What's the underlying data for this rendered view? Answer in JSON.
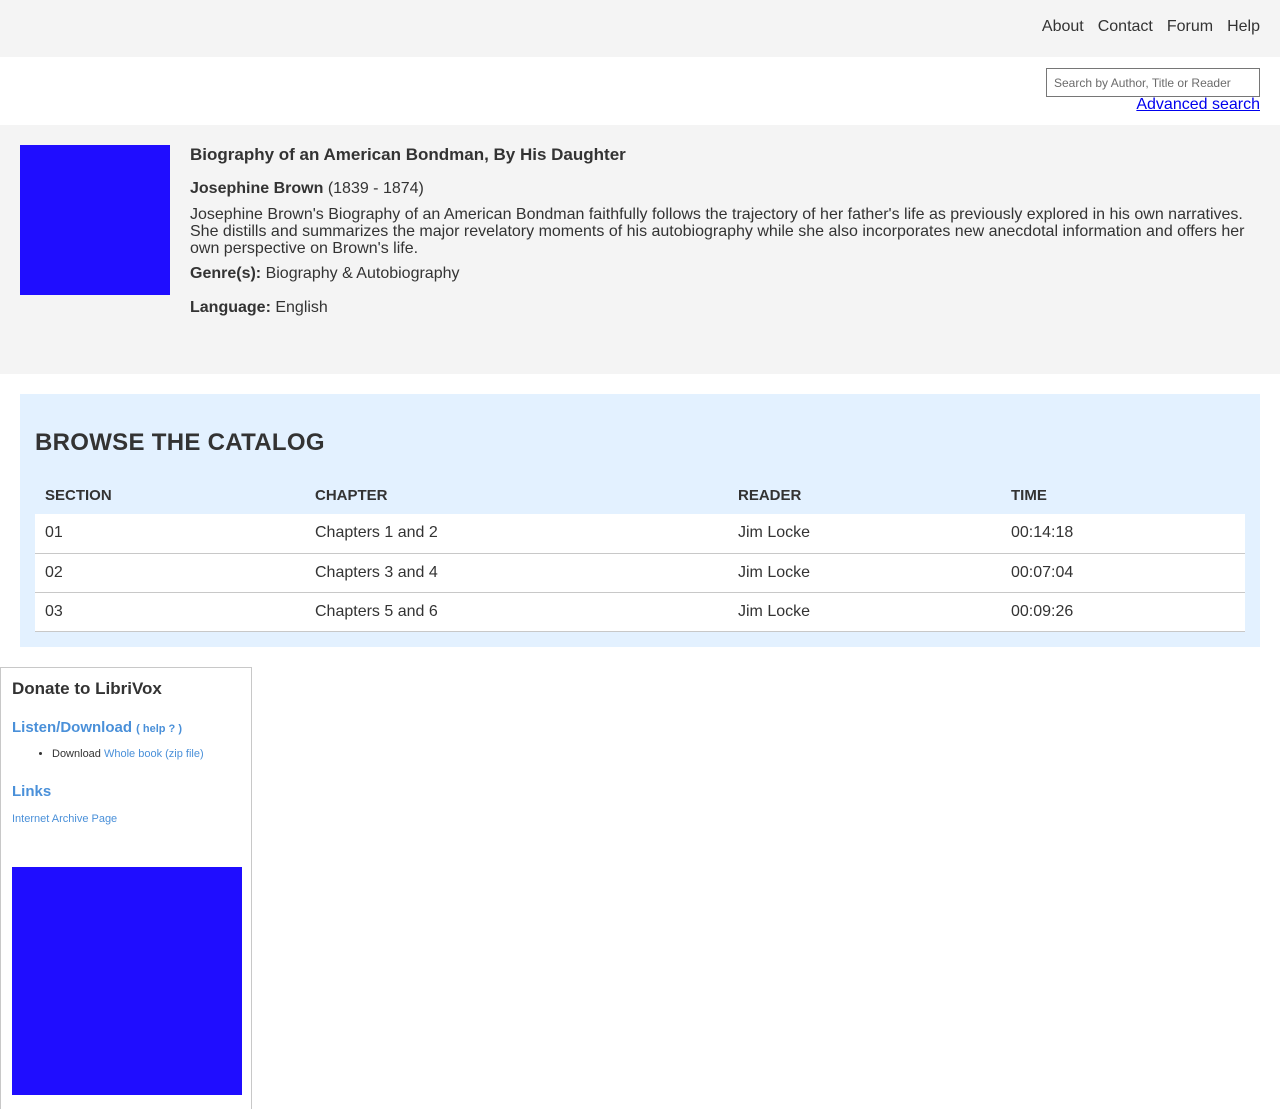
{
  "nav": {
    "items": [
      "About",
      "Contact",
      "Forum",
      "Help"
    ]
  },
  "search": {
    "placeholder": "Search by Author, Title or Reader",
    "advanced_label": "Advanced search"
  },
  "book": {
    "title": "Biography of an American Bondman, By His Daughter",
    "author": "Josephine Brown",
    "author_dates": "(1839 - 1874)",
    "description": "Josephine Brown's Biography of an American Bondman faithfully follows the trajectory of her father's life as previously explored in his own narratives. She distills and summarizes the major revelatory moments of his autobiography while she also incorporates new anecdotal information and offers her own perspective on Brown's life.",
    "genre_label": "Genre(s):",
    "genre": "Biography & Autobiography",
    "language_label": "Language:",
    "language": "English",
    "cover_color": "#1f0dff"
  },
  "catalog": {
    "title": "BROWSE THE CATALOG",
    "columns": [
      "SECTION",
      "CHAPTER",
      "READER",
      "TIME"
    ],
    "rows": [
      [
        "01",
        "Chapters 1 and 2",
        "Jim Locke",
        "00:14:18"
      ],
      [
        "02",
        "Chapters 3 and 4",
        "Jim Locke",
        "00:07:04"
      ],
      [
        "03",
        "Chapters 5 and 6",
        "Jim Locke",
        "00:09:26"
      ]
    ]
  },
  "sidebar": {
    "donate": "Donate to LibriVox",
    "listen_heading": "Listen/Download",
    "help_label": "( help ? )",
    "download_prefix": "Download",
    "download_link": "Whole book (zip file)",
    "links_heading": "Links",
    "ia_link": "Internet Archive Page"
  },
  "colors": {
    "link_blue": "#4a90d9",
    "panel_gray": "#f4f4f4",
    "catalog_bg": "#e3f1ff",
    "image_blue": "#1f0dff"
  }
}
